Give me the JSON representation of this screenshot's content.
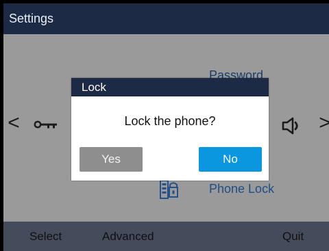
{
  "titlebar": {
    "title": "Settings"
  },
  "menu": {
    "top_label": "Password",
    "bottom_label": "Phone Lock",
    "left_arrow": "<",
    "right_arrow": ">",
    "icons": [
      "key-icon",
      "lock-device-icon",
      "speaker-icon"
    ]
  },
  "dialog": {
    "title": "Lock",
    "message": "Lock the phone?",
    "yes_label": "Yes",
    "no_label": "No"
  },
  "softkeys": {
    "select": "Select",
    "advanced": "Advanced",
    "quit": "Quit"
  },
  "colors": {
    "header_bg": "#1d2a45",
    "content_dim": "#9a9a9a",
    "softkey_bg": "#444c5c",
    "accent_button": "#0a97e0",
    "secondary_button": "#8e8e8e"
  }
}
